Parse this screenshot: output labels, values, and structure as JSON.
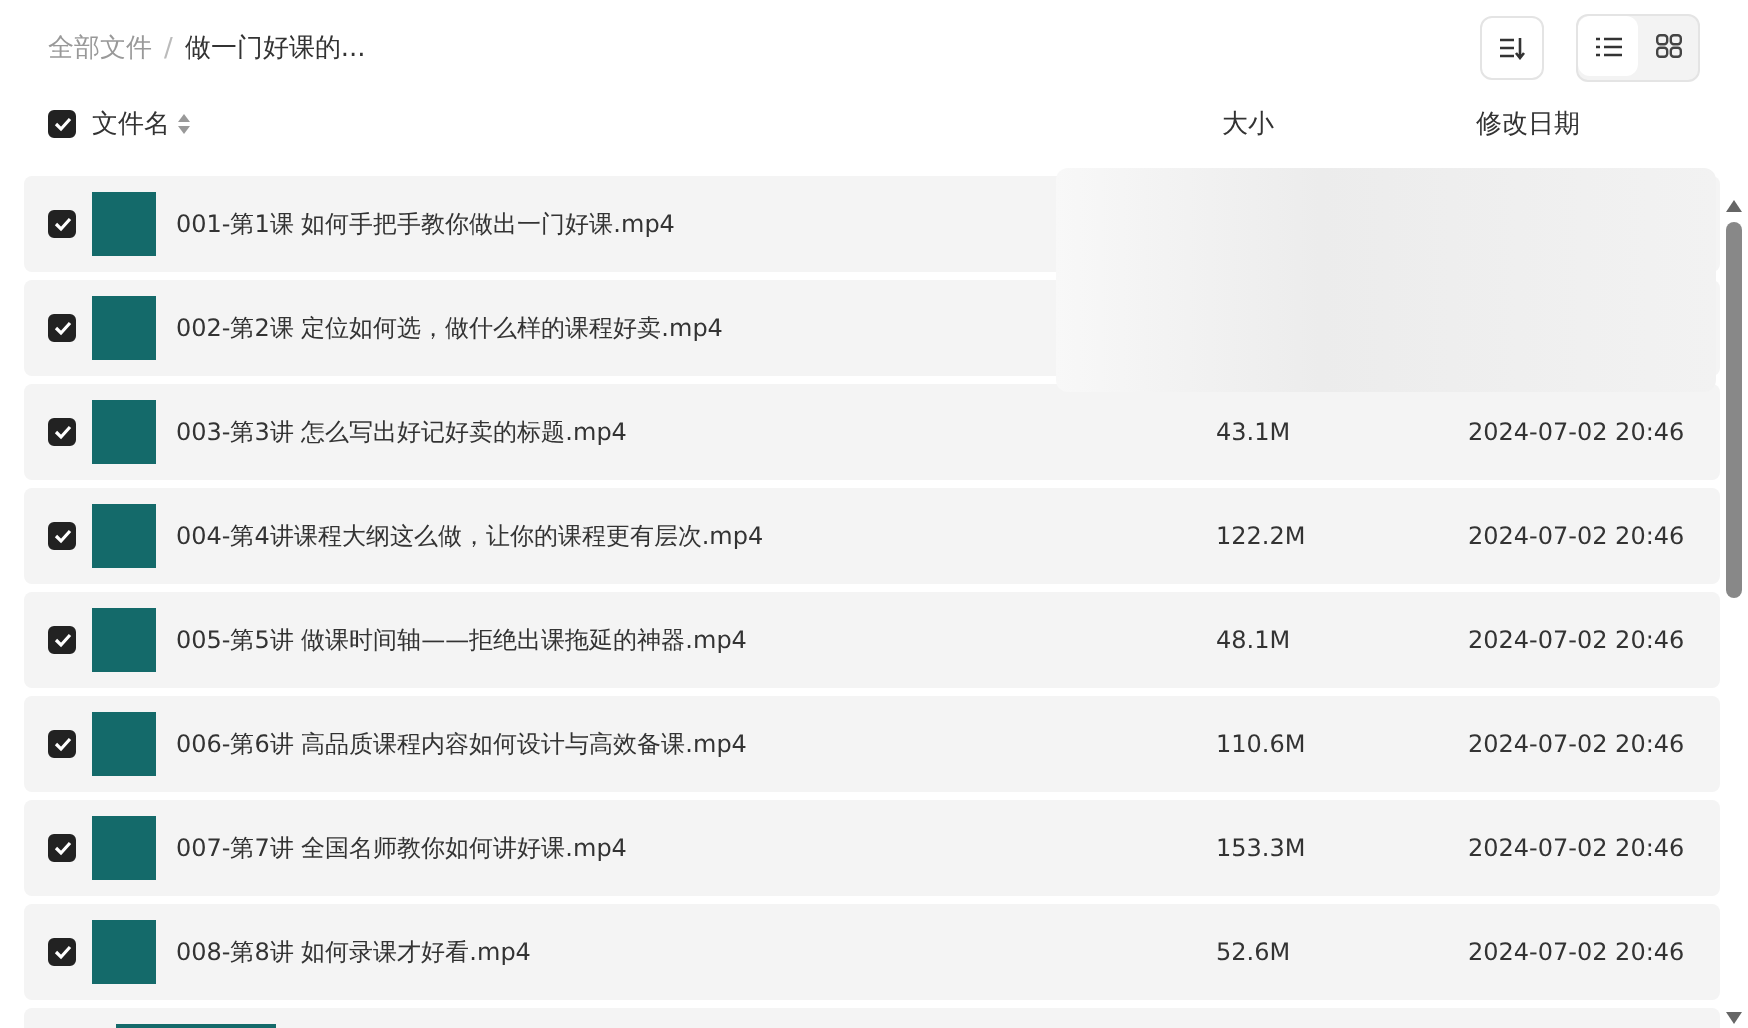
{
  "breadcrumb": {
    "root": "全部文件",
    "separator": "/",
    "current": "做一门好课的..."
  },
  "view_modes": [
    {
      "kind": "list",
      "selected": true
    },
    {
      "kind": "grid",
      "selected": false
    }
  ],
  "header": {
    "checked": true,
    "name": "文件名",
    "size": "大小",
    "date": "修改日期"
  },
  "rows": [
    {
      "checked": true,
      "name": "001-第1课 如何手把手教你做出一门好课.mp4"
    },
    {
      "checked": true,
      "name": "002-第2课 定位如何选，做什么样的课程好卖.mp4"
    },
    {
      "checked": true,
      "name": "003-第3讲 怎么写出好记好卖的标题.mp4",
      "size": "43.1M",
      "date": "2024-07-02 20:46"
    },
    {
      "checked": true,
      "name": "004-第4讲课程大纲这么做，让你的课程更有层次.mp4",
      "size": "122.2M",
      "date": "2024-07-02 20:46"
    },
    {
      "checked": true,
      "name": "005-第5讲 做课时间轴——拒绝出课拖延的神器.mp4",
      "size": "48.1M",
      "date": "2024-07-02 20:46"
    },
    {
      "checked": true,
      "name": "006-第6讲 高品质课程内容如何设计与高效备课.mp4",
      "size": "110.6M",
      "date": "2024-07-02 20:46"
    },
    {
      "checked": true,
      "name": "007-第7讲 全国名师教你如何讲好课.mp4",
      "size": "153.3M",
      "date": "2024-07-02 20:46"
    },
    {
      "checked": true,
      "name": "008-第8讲 如何录课才好看.mp4",
      "size": "52.6M",
      "date": "2024-07-02 20:46"
    }
  ]
}
